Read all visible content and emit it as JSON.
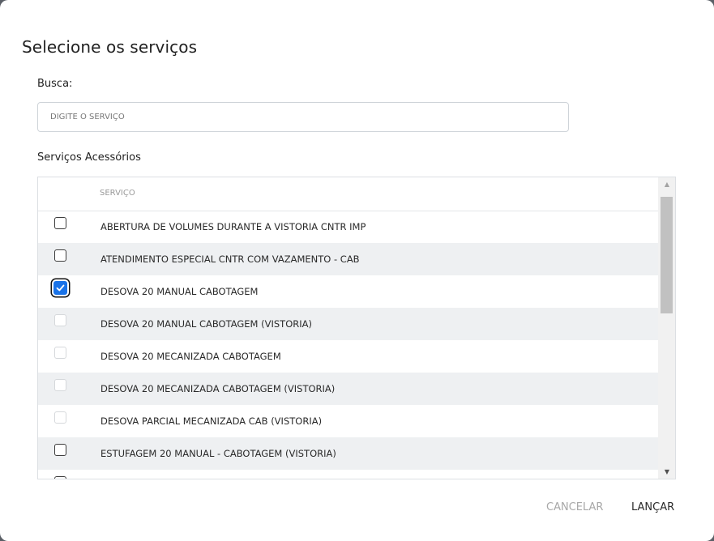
{
  "dialog": {
    "title": "Selecione os serviços",
    "search_label": "Busca:",
    "search_placeholder": "DIGITE O SERVIÇO",
    "search_value": "",
    "section_label": "Serviços Acessórios",
    "column_header": "SERVIÇO",
    "scroll_up_glyph": "▲",
    "scroll_down_glyph": "▼",
    "rows": [
      {
        "label": "ABERTURA DE VOLUMES DURANTE A VISTORIA CNTR IMP",
        "checked": false,
        "disabled": false
      },
      {
        "label": "ATENDIMENTO ESPECIAL CNTR COM VAZAMENTO - CAB",
        "checked": false,
        "disabled": false
      },
      {
        "label": "DESOVA 20 MANUAL CABOTAGEM",
        "checked": true,
        "disabled": false
      },
      {
        "label": "DESOVA 20 MANUAL CABOTAGEM (VISTORIA)",
        "checked": false,
        "disabled": true
      },
      {
        "label": "DESOVA 20 MECANIZADA CABOTAGEM",
        "checked": false,
        "disabled": true
      },
      {
        "label": "DESOVA 20 MECANIZADA CABOTAGEM (VISTORIA)",
        "checked": false,
        "disabled": true
      },
      {
        "label": "DESOVA PARCIAL MECANIZADA CAB (VISTORIA)",
        "checked": false,
        "disabled": true
      },
      {
        "label": "ESTUFAGEM 20 MANUAL - CABOTAGEM (VISTORIA)",
        "checked": false,
        "disabled": false
      },
      {
        "label": "",
        "checked": false,
        "disabled": false
      }
    ],
    "cancel_label": "CANCELAR",
    "launch_label": "LANÇAR"
  },
  "colors": {
    "accent": "#1a73e8",
    "row_alt": "#eef0f2",
    "cancel_disabled": "#a8a8a8"
  }
}
